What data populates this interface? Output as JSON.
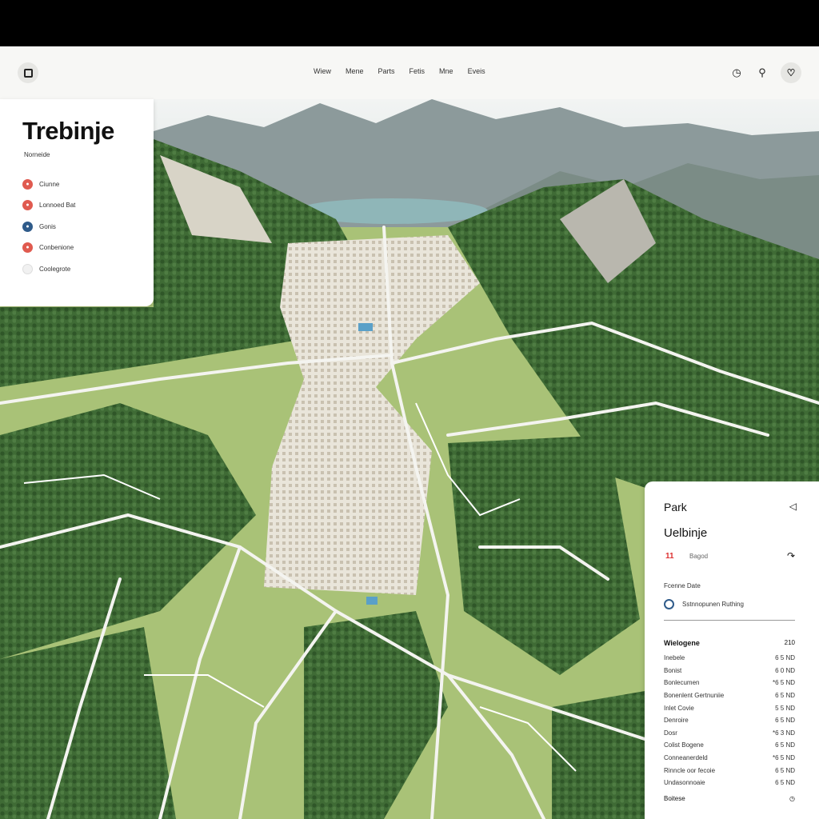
{
  "header": {
    "nav": [
      "Wiew",
      "Mene",
      "Parts",
      "Fetis",
      "Mne",
      "Eveis"
    ],
    "icons": [
      "bell-icon",
      "user-icon",
      "avatar"
    ]
  },
  "left_panel": {
    "city": "Trebinje",
    "subtitle": "Norneide",
    "legend": [
      {
        "label": "Ciunne",
        "color": "#e05a4f",
        "icon": "leaf-icon"
      },
      {
        "label": "Lonnoed Bat",
        "color": "#e05a4f",
        "icon": "tag-icon"
      },
      {
        "label": "Gonis",
        "color": "#2f5b8a",
        "icon": "info-icon"
      },
      {
        "label": "Conbenione",
        "color": "#e05a4f",
        "icon": "pin-icon"
      },
      {
        "label": "Coolegrote",
        "color": "#dddddd",
        "icon": "circle-icon"
      }
    ]
  },
  "right_panel": {
    "title": "Park",
    "name": "Uelbinje",
    "tag_icon": "11",
    "tag": "Bagod",
    "section": "Fcenne Date",
    "status": "Sstnnopunen Ruthing",
    "table_header": {
      "label": "Wielogene",
      "value": "210"
    },
    "rows": [
      {
        "label": "Inebele",
        "value": "6 5 ND"
      },
      {
        "label": "Bonist",
        "value": "6 0 ND"
      },
      {
        "label": "Bonlecumen",
        "value": "*6 5 ND"
      },
      {
        "label": "Bonenlent Gertnuniie",
        "value": "6 5 ND"
      },
      {
        "label": "Inlet Covie",
        "value": "5 5 ND"
      },
      {
        "label": "Denroire",
        "value": "6 5 ND"
      },
      {
        "label": "Dosr",
        "value": "*6 3 ND"
      },
      {
        "label": "Colist Bogene",
        "value": "6 5 ND"
      },
      {
        "label": "Conneanerdeld",
        "value": "*6 5 ND"
      },
      {
        "label": "Rinncle oor fecoie",
        "value": "6 5 ND"
      },
      {
        "label": "Undasonnoaie",
        "value": "6 5 ND"
      }
    ],
    "footer": "Boitese"
  },
  "colors": {
    "forest": "#3f6b35",
    "meadow": "#a9c277",
    "road": "#f4f4f0",
    "mountain": "#8a9a9a",
    "lake": "#8fb6b8",
    "town": "#d8d2c4"
  }
}
